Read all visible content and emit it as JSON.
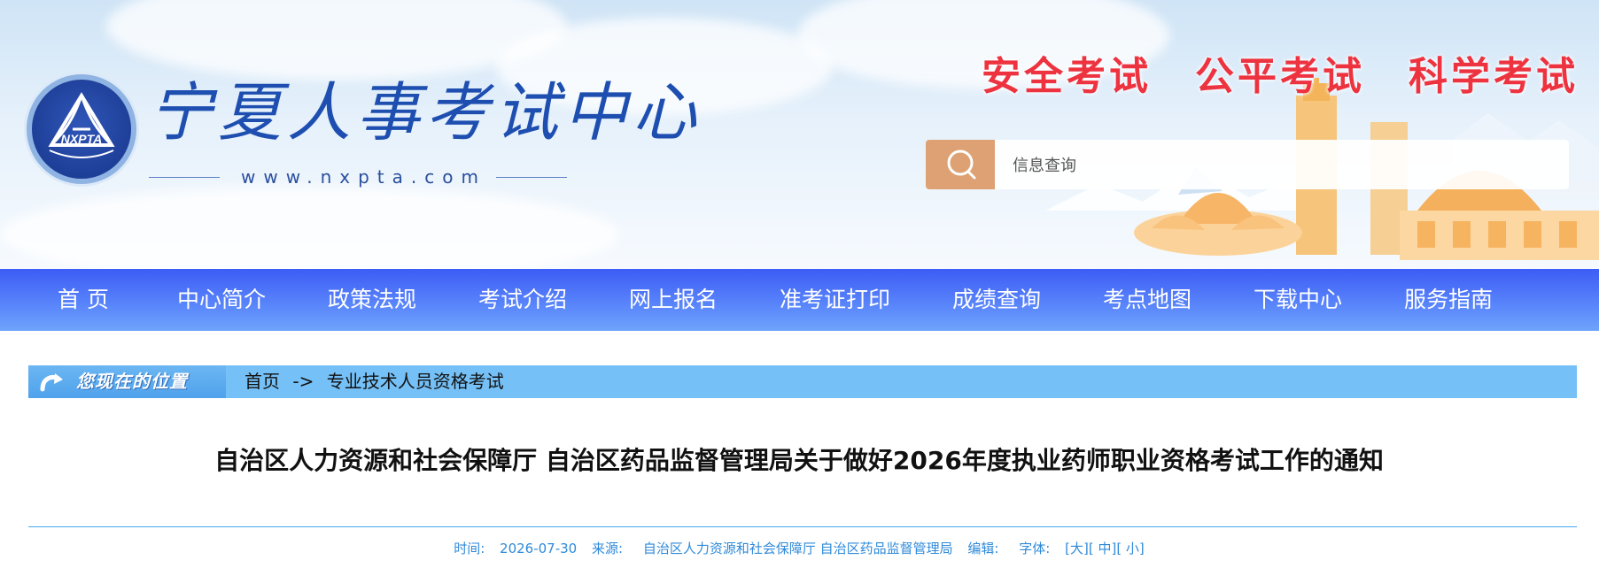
{
  "header": {
    "logo_text": "NXPTA",
    "site_name": "宁夏人事考试中心",
    "site_url": "www.nxpta.com",
    "slogans": [
      "安全考试",
      "公平考试",
      "科学考试"
    ],
    "search": {
      "placeholder": "信息查询",
      "icon": "search-icon"
    }
  },
  "nav": {
    "items": [
      "首 页",
      "中心简介",
      "政策法规",
      "考试介绍",
      "网上报名",
      "准考证打印",
      "成绩查询",
      "考点地图",
      "下载中心",
      "服务指南"
    ]
  },
  "breadcrumb": {
    "label": "您现在的位置",
    "home": "首页",
    "separator": "->",
    "current": "专业技术人员资格考试"
  },
  "article": {
    "title": "自治区人力资源和社会保障厅 自治区药品监督管理局关于做好2026年度执业药师职业资格考试工作的通知",
    "meta": {
      "time_label": "时间:",
      "time": "2026-07-30",
      "source_label": "来源:",
      "source": "自治区人力资源和社会保障厅 自治区药品监督管理局",
      "editor_label": "编辑:",
      "font_label": "字体:",
      "size_large": "[大]",
      "size_medium": "[ 中]",
      "size_small": "[ 小]"
    }
  },
  "colors": {
    "nav_gradient_top": "#3d5df5",
    "nav_gradient_bottom": "#6ea4fb",
    "slogan": "#ee3340",
    "breadcrumb_bar": "#75c0f6",
    "meta_text": "#2f8ad9",
    "search_button": "#dda173"
  }
}
